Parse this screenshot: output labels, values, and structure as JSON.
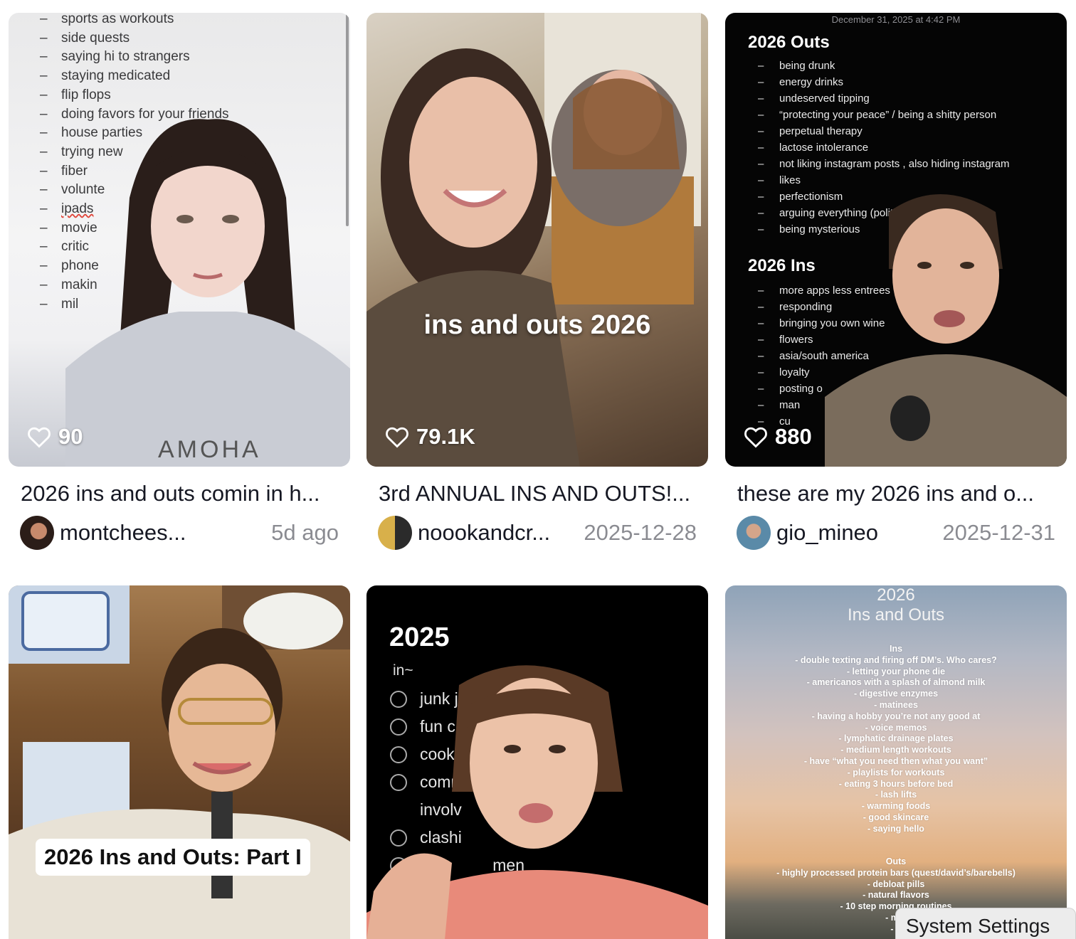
{
  "videos": [
    {
      "likes": "90",
      "title": "2026 ins and outs comin in h...",
      "author": "montchees...",
      "date": "5d ago",
      "overlay_lines": [
        "sports as workouts",
        "side quests",
        "saying hi to strangers",
        "staying medicated",
        "flip flops",
        "doing favors for your friends",
        "house parties",
        "trying new",
        "fiber",
        "volunte",
        "ipads",
        "movie",
        "critic",
        "phone",
        "makin",
        "mil"
      ]
    },
    {
      "likes": "79.1K",
      "title": "3rd ANNUAL INS AND OUTS!...",
      "author": "noookandcr...",
      "date": "2025-12-28",
      "overlay_caption": "ins and outs 2026"
    },
    {
      "likes": "880",
      "title": "these are my 2026 ins and o...",
      "author": "gio_mineo",
      "date": "2025-12-31",
      "overlay_stamp": "December 31, 2025 at 4:42 PM",
      "outs_heading": "2026 Outs",
      "outs": [
        "being drunk",
        "energy drinks",
        "undeserved tipping",
        "“protecting your peace” / being a shitty person",
        "perpetual therapy",
        "lactose intolerance",
        "not liking instagram posts , also hiding instagram",
        "likes",
        "perfectionism",
        "arguing everything (politi",
        "being mysterious"
      ],
      "ins_heading": "2026 Ins",
      "ins": [
        "more apps less entrees",
        "responding",
        "bringing you own wine",
        "flowers",
        "asia/south america",
        "loyalty",
        "posting o",
        "man",
        "cu"
      ]
    },
    {
      "overlay_label": "2026 Ins and Outs: Part I"
    },
    {
      "overlay_year": "2025",
      "overlay_sub": "in~",
      "checklist": [
        "junk j           ks, etc",
        "fun c",
        "cooki",
        "comm",
        "involv",
        "clashi",
        "                men"
      ]
    },
    {
      "overlay_year": "2026",
      "overlay_heading": "Ins and Outs",
      "ins_label": "Ins",
      "ins": [
        "- double texting and firing off DM’s. Who cares?",
        "- letting your phone die",
        "- americanos with a splash of almond milk",
        "- digestive enzymes",
        "- matinees",
        "- having a hobby you’re not any good at",
        "- voice memos",
        "- lymphatic drainage plates",
        "- medium length workouts",
        "- have “what you need then what you want”",
        "- playlists for workouts",
        "- eating 3 hours before bed",
        "- lash lifts",
        "- warming foods",
        "- good skincare",
        "- saying hello"
      ],
      "outs_label": "Outs",
      "outs": [
        "- highly processed protein bars (quest/david’s/barebells)",
        "- debloat pills",
        "- natural flavors",
        "- 10 step morning routines",
        "- mat",
        "- g"
      ]
    }
  ],
  "system_toast": "System Settings",
  "icons": {
    "like": "heart-outline-icon"
  }
}
